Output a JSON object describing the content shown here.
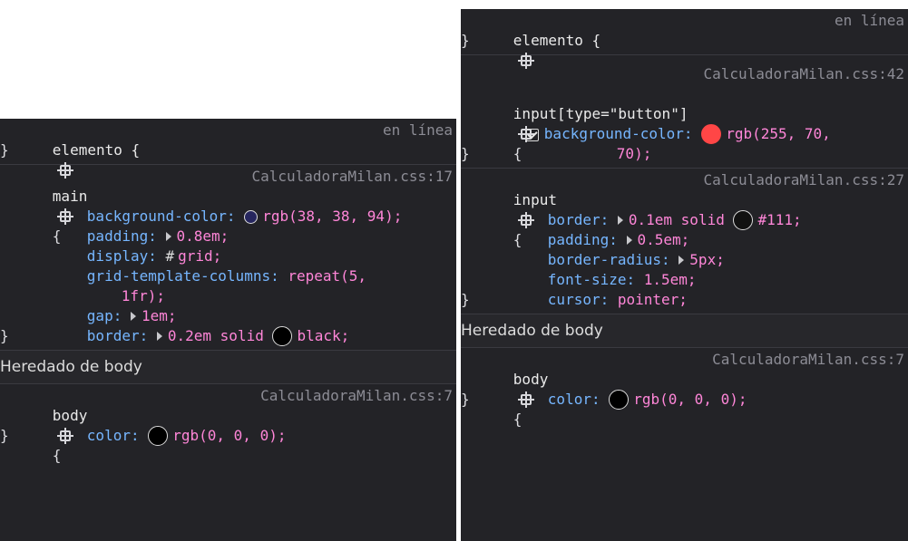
{
  "left_panel": {
    "element_rule": {
      "selector": "elemento {",
      "source": "en línea",
      "close": "}"
    },
    "main_rule": {
      "selector": "main",
      "open": "{",
      "source": "CalculadoraMilan.css:17",
      "close": "}",
      "declarations": {
        "bg_prop": "background-color:",
        "bg_val": "rgb(38, 38, 94);",
        "bg_color": "#26265e",
        "padding_prop": "padding:",
        "padding_val": "0.8em;",
        "display_prop": "display:",
        "display_icon": "#",
        "display_val": "grid;",
        "gtc_prop": "grid-template-columns:",
        "gtc_val": "repeat(5,",
        "gtc_cont": "1fr);",
        "gap_prop": "gap:",
        "gap_val": "1em;",
        "border_prop": "border:",
        "border_val1": "0.2em solid",
        "border_val2": "black;",
        "border_color": "#000000"
      }
    },
    "inherited_label": "Heredado de body",
    "body_rule": {
      "selector": "body",
      "open": "{",
      "source": "CalculadoraMilan.css:7",
      "close": "}",
      "color_prop": "color:",
      "color_val": "rgb(0, 0, 0);",
      "color_swatch": "#000000"
    }
  },
  "right_panel": {
    "element_rule": {
      "selector": "elemento {",
      "source": "en línea",
      "close": "}"
    },
    "button_rule": {
      "source": "CalculadoraMilan.css:42",
      "selector": "input[type=\"button\"]",
      "open": "{",
      "bg_prop": "background-color:",
      "bg_val": "rgb(255, 70,",
      "bg_cont": "70);",
      "bg_color": "#ff4646",
      "close": "}"
    },
    "input_rule": {
      "selector": "input",
      "open": "{",
      "source": "CalculadoraMilan.css:27",
      "border_prop": "border:",
      "border_val1": "0.1em solid",
      "border_val2": "#111;",
      "border_color": "#111111",
      "padding_prop": "padding:",
      "padding_val": "0.5em;",
      "radius_prop": "border-radius:",
      "radius_val": "5px;",
      "fontsize_prop": "font-size:",
      "fontsize_val": "1.5em;",
      "cursor_prop": "cursor:",
      "cursor_val": "pointer;",
      "close": "}"
    },
    "inherited_label": "Heredado de body",
    "body_rule": {
      "selector": "body",
      "open": "{",
      "source": "CalculadoraMilan.css:7",
      "close": "}",
      "color_prop": "color:",
      "color_val": "rgb(0, 0, 0);",
      "color_swatch": "#000000"
    }
  }
}
